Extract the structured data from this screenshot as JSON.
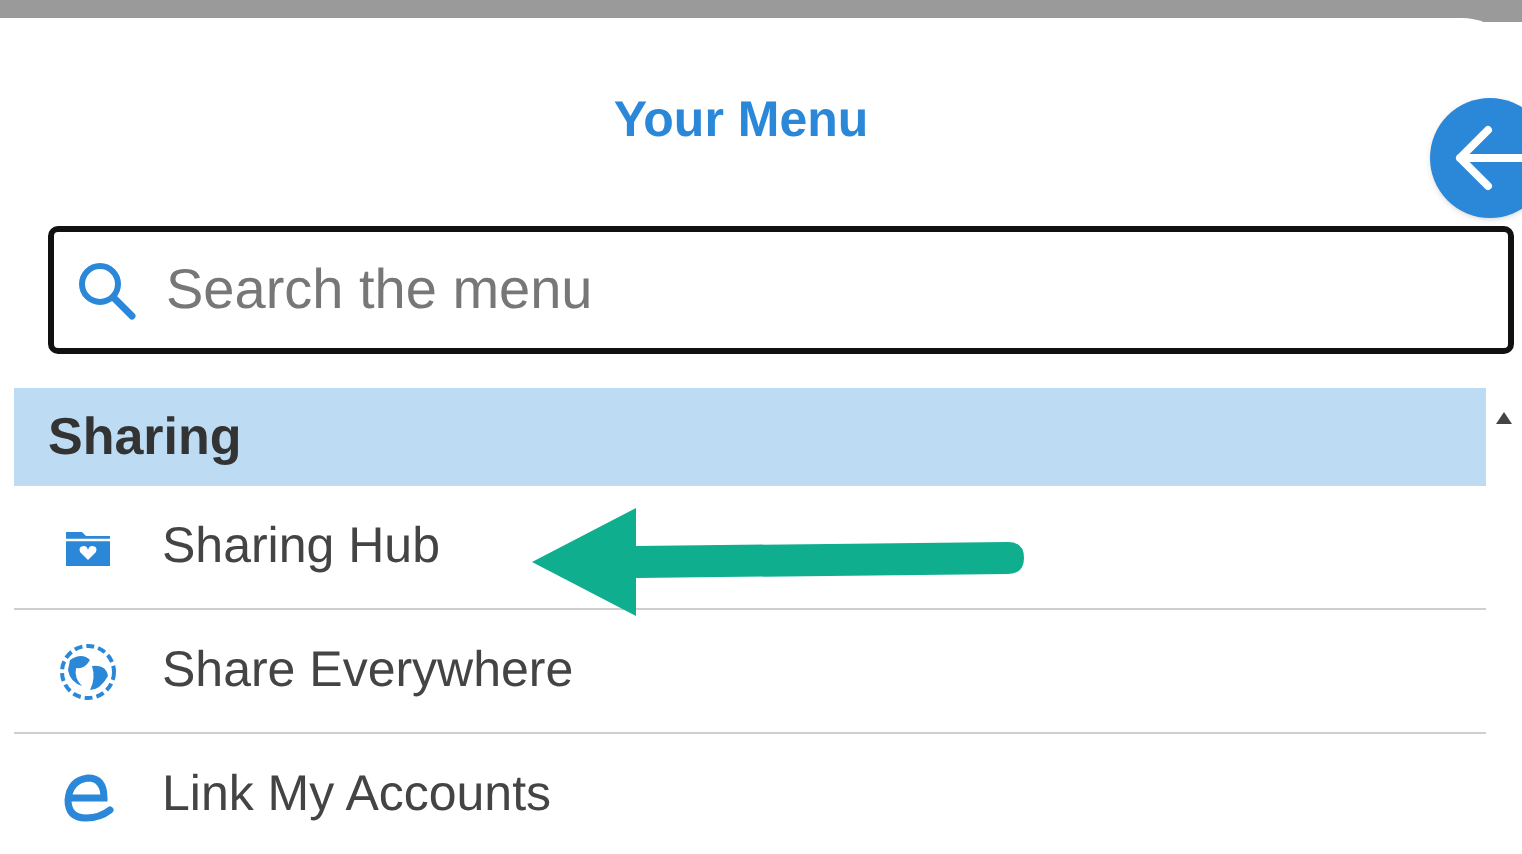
{
  "title": "Your Menu",
  "search": {
    "placeholder": "Search the menu"
  },
  "section": {
    "title": "Sharing"
  },
  "items": [
    {
      "label": "Sharing Hub"
    },
    {
      "label": "Share Everywhere"
    },
    {
      "label": "Link My Accounts"
    }
  ]
}
